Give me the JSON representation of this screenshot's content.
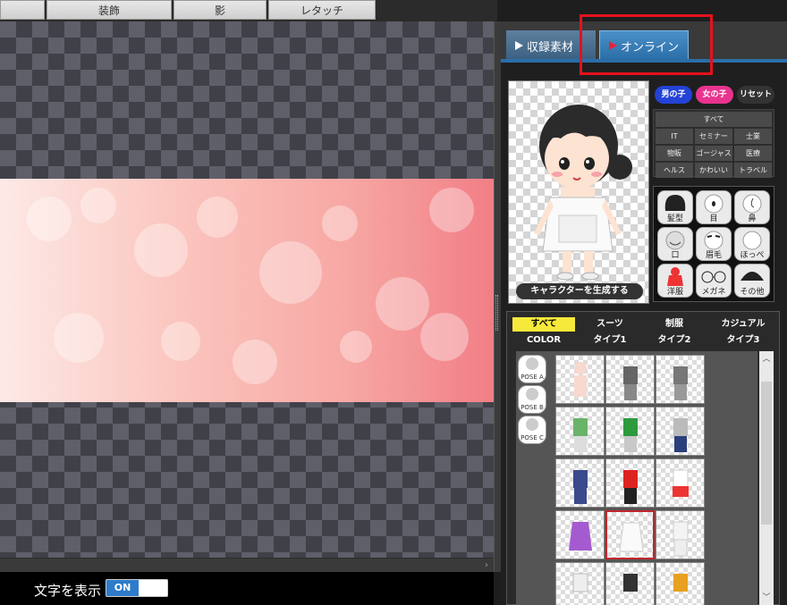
{
  "toolbar": {
    "tabs": [
      {
        "label": ""
      },
      {
        "label": "装飾"
      },
      {
        "label": "影"
      },
      {
        "label": "レタッチ"
      }
    ]
  },
  "canvas": {
    "show_text_label": "文字を表示",
    "toggle_on_label": "ON"
  },
  "panel": {
    "tab_local": "収録素材",
    "tab_online": "オンライン",
    "generate_label": "キャラクターを生成する",
    "gender": {
      "boy": "男の子",
      "girl": "女の子",
      "reset": "リセット"
    },
    "categories": [
      "すべて",
      "IT",
      "セミナー",
      "士業",
      "物販",
      "ゴージャス",
      "医療",
      "ヘルス",
      "かわいい",
      "トラベル"
    ],
    "parts": [
      "髪型",
      "目",
      "鼻",
      "口",
      "眉毛",
      "ほっぺ",
      "洋服",
      "メガネ",
      "その他"
    ],
    "filters_row1": [
      "すべて",
      "スーツ",
      "制服",
      "カジュアル"
    ],
    "filters_row2": [
      "COLOR",
      "タイプ1",
      "タイプ2",
      "タイプ3"
    ],
    "poses": [
      "POSE A",
      "POSE B",
      "POSE C"
    ]
  },
  "colors": {
    "accent_blue": "#2b6ea8",
    "highlight_red": "#e3121c",
    "filter_yellow": "#f7e93b",
    "boy_blue": "#2442d6",
    "girl_pink": "#e8338f"
  }
}
